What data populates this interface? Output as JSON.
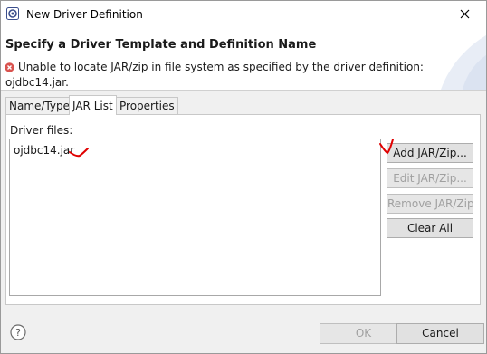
{
  "window": {
    "title": "New Driver Definition"
  },
  "header": {
    "title": "Specify a Driver Template and Definition Name",
    "error_message": "Unable to locate JAR/zip in file system as specified by the driver definition:",
    "error_detail": "ojdbc14.jar."
  },
  "tabs": [
    {
      "label": "Name/Type",
      "active": false
    },
    {
      "label": "JAR List",
      "active": true
    },
    {
      "label": "Properties",
      "active": false
    }
  ],
  "jar_list": {
    "driver_files_label": "Driver files:",
    "files": [
      "ojdbc14.jar"
    ],
    "buttons": {
      "add": "Add JAR/Zip...",
      "edit": "Edit JAR/Zip...",
      "remove": "Remove JAR/Zip",
      "clear": "Clear All"
    }
  },
  "footer": {
    "ok": "OK",
    "cancel": "Cancel"
  },
  "icons": {
    "app": "eclipse-datatools-icon",
    "close": "close-icon",
    "error": "error-icon",
    "help": "help-icon"
  },
  "colors": {
    "error": "#d9534f",
    "annotation": "#e00000",
    "accent": "#4a63a8"
  }
}
